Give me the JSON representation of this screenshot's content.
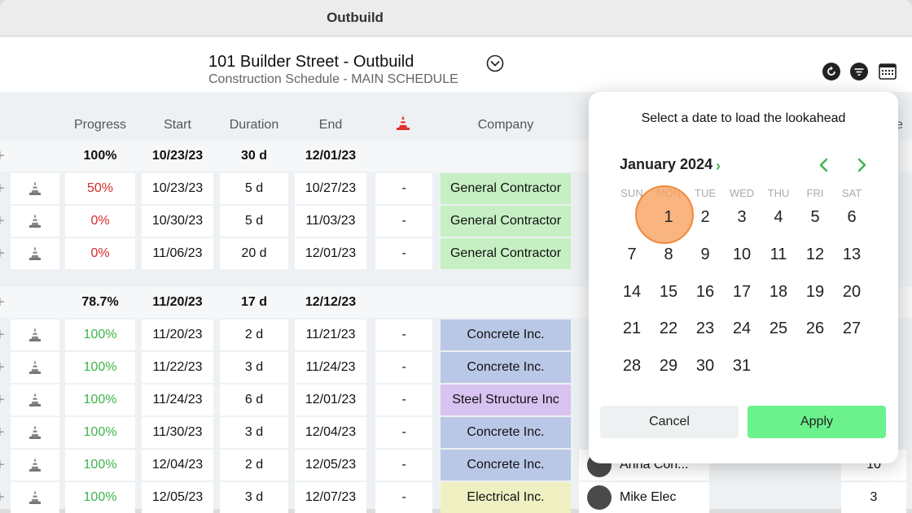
{
  "window": {
    "title": "Outbuild"
  },
  "header": {
    "project_title": "101 Builder Street - Outbuild",
    "subtitle": "Construction Schedule - MAIN SCHEDULE",
    "icons": [
      "chevron-down-circle-icon",
      "refresh-icon",
      "filter-icon",
      "calendar-icon"
    ]
  },
  "table": {
    "columns": [
      "Progress",
      "Start",
      "Duration",
      "End",
      "",
      "Company"
    ],
    "rows": [
      {
        "type": "summary",
        "progress": "100%",
        "start": "10/23/23",
        "duration": "30 d",
        "end": "12/01/23"
      },
      {
        "type": "task",
        "progress": "50%",
        "progress_color": "#d62b2b",
        "start": "10/23/23",
        "duration": "5 d",
        "end": "10/27/23",
        "constraint": "-",
        "company": "General Contractor",
        "company_color": "#c6f0c3"
      },
      {
        "type": "task",
        "progress": "0%",
        "progress_color": "#d62b2b",
        "start": "10/30/23",
        "duration": "5 d",
        "end": "11/03/23",
        "constraint": "-",
        "company": "General Contractor",
        "company_color": "#c6f0c3"
      },
      {
        "type": "task",
        "progress": "0%",
        "progress_color": "#d62b2b",
        "start": "11/06/23",
        "duration": "20 d",
        "end": "12/01/23",
        "constraint": "-",
        "company": "General Contractor",
        "company_color": "#c6f0c3"
      },
      {
        "type": "summary",
        "progress": "78.7%",
        "start": "11/20/23",
        "duration": "17 d",
        "end": "12/12/23"
      },
      {
        "type": "task",
        "progress": "100%",
        "progress_color": "#3cb54a",
        "start": "11/20/23",
        "duration": "2 d",
        "end": "11/21/23",
        "constraint": "-",
        "company": "Concrete Inc.",
        "company_color": "#b9c8e6"
      },
      {
        "type": "task",
        "progress": "100%",
        "progress_color": "#3cb54a",
        "start": "11/22/23",
        "duration": "3 d",
        "end": "11/24/23",
        "constraint": "-",
        "company": "Concrete Inc.",
        "company_color": "#b9c8e6"
      },
      {
        "type": "task",
        "progress": "100%",
        "progress_color": "#3cb54a",
        "start": "11/24/23",
        "duration": "6 d",
        "end": "12/01/23",
        "constraint": "-",
        "company": "Steel Structure Inc",
        "company_color": "#d8c2f0"
      },
      {
        "type": "task",
        "progress": "100%",
        "progress_color": "#3cb54a",
        "start": "11/30/23",
        "duration": "3 d",
        "end": "12/04/23",
        "constraint": "-",
        "company": "Concrete Inc.",
        "company_color": "#b9c8e6"
      },
      {
        "type": "task",
        "progress": "100%",
        "progress_color": "#3cb54a",
        "start": "12/04/23",
        "duration": "2 d",
        "end": "12/05/23",
        "constraint": "-",
        "company": "Concrete Inc.",
        "company_color": "#b9c8e6",
        "person": "Anna Con...",
        "extra": "10"
      },
      {
        "type": "task",
        "progress": "100%",
        "progress_color": "#3cb54a",
        "start": "12/05/23",
        "duration": "3 d",
        "end": "12/07/23",
        "constraint": "-",
        "company": "Electrical Inc.",
        "company_color": "#eef0c2",
        "person": "Mike Elec",
        "extra": "3"
      }
    ]
  },
  "datepicker": {
    "title": "Select a date to load the lookahead",
    "month_label": "January 2024",
    "weekdays": [
      "SUN",
      "MON",
      "TUE",
      "WED",
      "THU",
      "FRI",
      "SAT"
    ],
    "weeks": [
      [
        "",
        "1",
        "2",
        "3",
        "4",
        "5",
        "6"
      ],
      [
        "7",
        "8",
        "9",
        "10",
        "11",
        "12",
        "13"
      ],
      [
        "14",
        "15",
        "16",
        "17",
        "18",
        "19",
        "20"
      ],
      [
        "21",
        "22",
        "23",
        "24",
        "25",
        "26",
        "27"
      ],
      [
        "28",
        "29",
        "30",
        "31",
        "",
        "",
        ""
      ]
    ],
    "selected_day": "1",
    "cancel_label": "Cancel",
    "apply_label": "Apply",
    "accent_color": "#3cb54a",
    "apply_color": "#6cf28d",
    "highlight_color": "#f7a160"
  },
  "partial_header": "e"
}
